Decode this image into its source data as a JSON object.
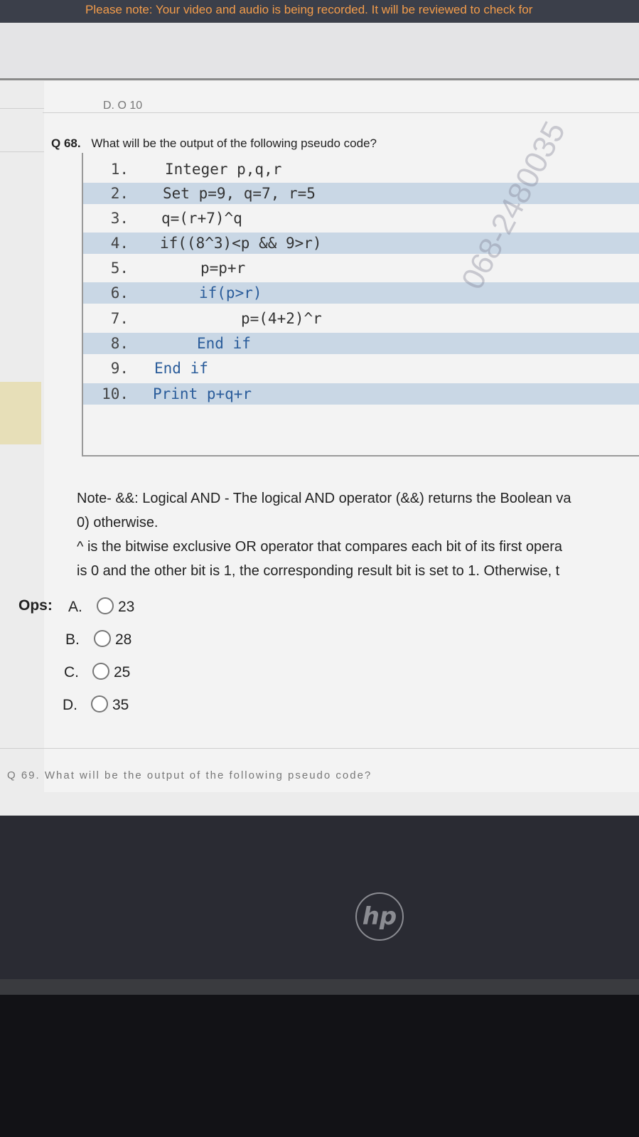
{
  "banner": {
    "text": "Please note: Your video and audio is being recorded. It will be reviewed to check for"
  },
  "previous_option": {
    "text": "D. O 10"
  },
  "question": {
    "number": "Q 68.",
    "text": "What will be the output of the following pseudo code?"
  },
  "code_lines": [
    {
      "num": "1.",
      "text": "Integer p,q,r"
    },
    {
      "num": "2.",
      "text": "Set p=9, q=7, r=5"
    },
    {
      "num": "3.",
      "text": "q=(r+7)^q"
    },
    {
      "num": "4.",
      "text": "if((8^3)<p && 9>r)"
    },
    {
      "num": "5.",
      "text": "p=p+r"
    },
    {
      "num": "6.",
      "text": "if(p>r)"
    },
    {
      "num": "7.",
      "text": "p=(4+2)^r"
    },
    {
      "num": "8.",
      "text": "End if"
    },
    {
      "num": "9.",
      "text": "End if"
    },
    {
      "num": "10.",
      "text": "Print p+q+r"
    }
  ],
  "note": {
    "line1": "Note- &&: Logical AND - The logical AND operator (&&) returns the Boolean va",
    "line2": "0) otherwise.",
    "line3": "^ is the bitwise exclusive OR operator that compares each bit of its first opera",
    "line4": "is 0 and the other bit is 1, the corresponding result bit is set to 1. Otherwise, t"
  },
  "options": {
    "label": "Ops:",
    "items": [
      {
        "letter": "A.",
        "value": "23"
      },
      {
        "letter": "B.",
        "value": "28"
      },
      {
        "letter": "C.",
        "value": "25"
      },
      {
        "letter": "D.",
        "value": "35"
      }
    ]
  },
  "next_question_cut": {
    "text": "Q 69. What will be the output of the following pseudo code?"
  },
  "watermark": {
    "text": "068-2480035"
  },
  "laptop": {
    "brand": "hp"
  }
}
